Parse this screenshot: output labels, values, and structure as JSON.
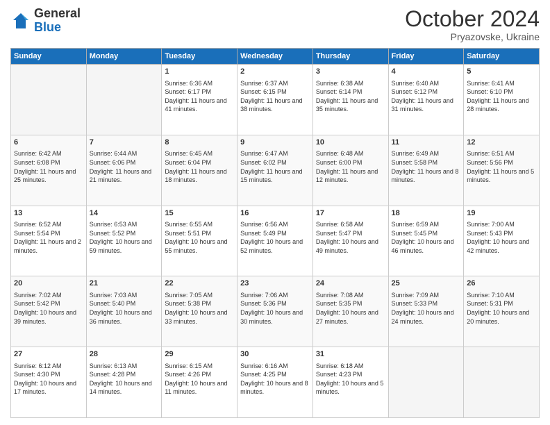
{
  "logo": {
    "general": "General",
    "blue": "Blue"
  },
  "title": {
    "month_year": "October 2024",
    "location": "Pryazovske, Ukraine"
  },
  "days_of_week": [
    "Sunday",
    "Monday",
    "Tuesday",
    "Wednesday",
    "Thursday",
    "Friday",
    "Saturday"
  ],
  "weeks": [
    [
      {
        "day": "",
        "info": ""
      },
      {
        "day": "",
        "info": ""
      },
      {
        "day": "1",
        "info": "Sunrise: 6:36 AM\nSunset: 6:17 PM\nDaylight: 11 hours and 41 minutes."
      },
      {
        "day": "2",
        "info": "Sunrise: 6:37 AM\nSunset: 6:15 PM\nDaylight: 11 hours and 38 minutes."
      },
      {
        "day": "3",
        "info": "Sunrise: 6:38 AM\nSunset: 6:14 PM\nDaylight: 11 hours and 35 minutes."
      },
      {
        "day": "4",
        "info": "Sunrise: 6:40 AM\nSunset: 6:12 PM\nDaylight: 11 hours and 31 minutes."
      },
      {
        "day": "5",
        "info": "Sunrise: 6:41 AM\nSunset: 6:10 PM\nDaylight: 11 hours and 28 minutes."
      }
    ],
    [
      {
        "day": "6",
        "info": "Sunrise: 6:42 AM\nSunset: 6:08 PM\nDaylight: 11 hours and 25 minutes."
      },
      {
        "day": "7",
        "info": "Sunrise: 6:44 AM\nSunset: 6:06 PM\nDaylight: 11 hours and 21 minutes."
      },
      {
        "day": "8",
        "info": "Sunrise: 6:45 AM\nSunset: 6:04 PM\nDaylight: 11 hours and 18 minutes."
      },
      {
        "day": "9",
        "info": "Sunrise: 6:47 AM\nSunset: 6:02 PM\nDaylight: 11 hours and 15 minutes."
      },
      {
        "day": "10",
        "info": "Sunrise: 6:48 AM\nSunset: 6:00 PM\nDaylight: 11 hours and 12 minutes."
      },
      {
        "day": "11",
        "info": "Sunrise: 6:49 AM\nSunset: 5:58 PM\nDaylight: 11 hours and 8 minutes."
      },
      {
        "day": "12",
        "info": "Sunrise: 6:51 AM\nSunset: 5:56 PM\nDaylight: 11 hours and 5 minutes."
      }
    ],
    [
      {
        "day": "13",
        "info": "Sunrise: 6:52 AM\nSunset: 5:54 PM\nDaylight: 11 hours and 2 minutes."
      },
      {
        "day": "14",
        "info": "Sunrise: 6:53 AM\nSunset: 5:52 PM\nDaylight: 10 hours and 59 minutes."
      },
      {
        "day": "15",
        "info": "Sunrise: 6:55 AM\nSunset: 5:51 PM\nDaylight: 10 hours and 55 minutes."
      },
      {
        "day": "16",
        "info": "Sunrise: 6:56 AM\nSunset: 5:49 PM\nDaylight: 10 hours and 52 minutes."
      },
      {
        "day": "17",
        "info": "Sunrise: 6:58 AM\nSunset: 5:47 PM\nDaylight: 10 hours and 49 minutes."
      },
      {
        "day": "18",
        "info": "Sunrise: 6:59 AM\nSunset: 5:45 PM\nDaylight: 10 hours and 46 minutes."
      },
      {
        "day": "19",
        "info": "Sunrise: 7:00 AM\nSunset: 5:43 PM\nDaylight: 10 hours and 42 minutes."
      }
    ],
    [
      {
        "day": "20",
        "info": "Sunrise: 7:02 AM\nSunset: 5:42 PM\nDaylight: 10 hours and 39 minutes."
      },
      {
        "day": "21",
        "info": "Sunrise: 7:03 AM\nSunset: 5:40 PM\nDaylight: 10 hours and 36 minutes."
      },
      {
        "day": "22",
        "info": "Sunrise: 7:05 AM\nSunset: 5:38 PM\nDaylight: 10 hours and 33 minutes."
      },
      {
        "day": "23",
        "info": "Sunrise: 7:06 AM\nSunset: 5:36 PM\nDaylight: 10 hours and 30 minutes."
      },
      {
        "day": "24",
        "info": "Sunrise: 7:08 AM\nSunset: 5:35 PM\nDaylight: 10 hours and 27 minutes."
      },
      {
        "day": "25",
        "info": "Sunrise: 7:09 AM\nSunset: 5:33 PM\nDaylight: 10 hours and 24 minutes."
      },
      {
        "day": "26",
        "info": "Sunrise: 7:10 AM\nSunset: 5:31 PM\nDaylight: 10 hours and 20 minutes."
      }
    ],
    [
      {
        "day": "27",
        "info": "Sunrise: 6:12 AM\nSunset: 4:30 PM\nDaylight: 10 hours and 17 minutes."
      },
      {
        "day": "28",
        "info": "Sunrise: 6:13 AM\nSunset: 4:28 PM\nDaylight: 10 hours and 14 minutes."
      },
      {
        "day": "29",
        "info": "Sunrise: 6:15 AM\nSunset: 4:26 PM\nDaylight: 10 hours and 11 minutes."
      },
      {
        "day": "30",
        "info": "Sunrise: 6:16 AM\nSunset: 4:25 PM\nDaylight: 10 hours and 8 minutes."
      },
      {
        "day": "31",
        "info": "Sunrise: 6:18 AM\nSunset: 4:23 PM\nDaylight: 10 hours and 5 minutes."
      },
      {
        "day": "",
        "info": ""
      },
      {
        "day": "",
        "info": ""
      }
    ]
  ]
}
